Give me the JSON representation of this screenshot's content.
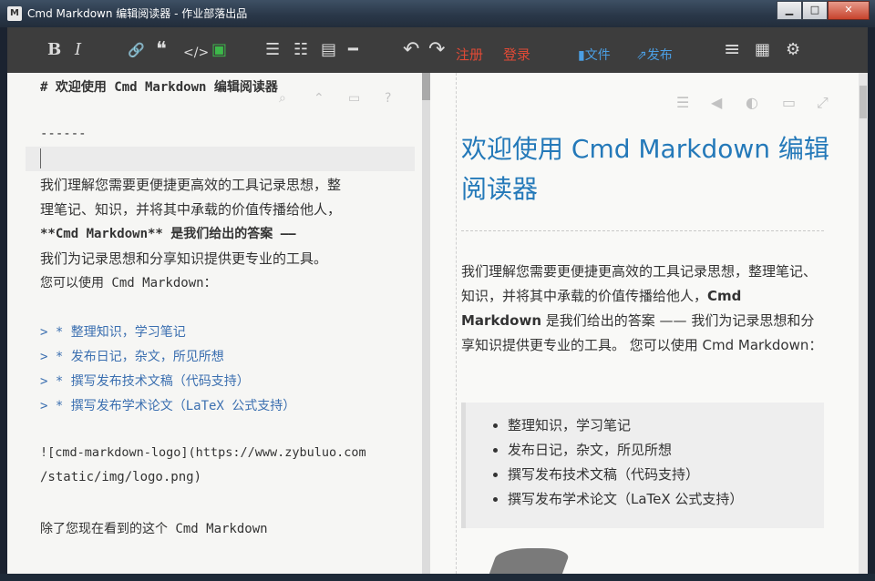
{
  "window": {
    "title": "Cmd Markdown 编辑阅读器 - 作业部落出品",
    "app_icon": "M",
    "minimize": "▁",
    "maximize": "□",
    "close": "✕"
  },
  "toolbar": {
    "bold": "B",
    "italic": "I",
    "link": "🔗",
    "quote": "❝",
    "code": "</>",
    "image": "▣",
    "ordered_list": "☰",
    "unordered_list": "☷",
    "heading": "▤",
    "hr": "━",
    "undo": "↶",
    "redo": "↷",
    "register": "注册",
    "login": "登录",
    "file": "文件",
    "publish": "发布",
    "menu": "≡",
    "layout": "▦",
    "settings": "⚙"
  },
  "editor": {
    "lines": [
      "# 欢迎使用 Cmd Markdown 编辑阅读器",
      "------",
      "我们理解您需要更便捷更高效的工具记录思想，整",
      "理笔记、知识，并将其中承载的价值传播给他人，",
      "**Cmd Markdown** 是我们给出的答案 ——",
      "我们为记录思想和分享知识提供更专业的工具。",
      "您可以使用 Cmd Markdown：",
      "> * 整理知识，学习笔记",
      "> * 发布日记，杂文，所见所想",
      "> * 撰写发布技术文稿（代码支持）",
      "> * 撰写发布学术论文（LaTeX 公式支持）",
      "![cmd-markdown-logo](https://www.zybuluo.com",
      "/static/img/logo.png)",
      "除了您现在看到的这个 Cmd Markdown"
    ],
    "icons": [
      "search-icon",
      "arrow-up-icon",
      "monitor-icon",
      "help-icon"
    ]
  },
  "preview": {
    "title": "欢迎使用 Cmd Markdown 编辑阅读器",
    "intro_pre": "我们理解您需要更便捷更高效的工具记录思想，整理笔记、知识，并将其中承载的价值传播给他人，",
    "intro_bold": "Cmd Markdown",
    "intro_post": " 是我们给出的答案 —— 我们为记录思想和分享知识提供更专业的工具。 您可以使用 Cmd Markdown：",
    "bullets": [
      "整理知识，学习笔记",
      "发布日记，杂文，所见所想",
      "撰写发布技术文稿（代码支持）",
      "撰写发布学术论文（LaTeX 公式支持）"
    ],
    "icons": [
      "list-icon",
      "chevron-left-icon",
      "contrast-icon",
      "monitor-icon",
      "fullscreen-icon"
    ]
  },
  "colors": {
    "accent": "#2479b9",
    "register_login": "#e04a36",
    "file_publish": "#4b9fe4",
    "toolbar_bg": "#3d3d3d"
  }
}
